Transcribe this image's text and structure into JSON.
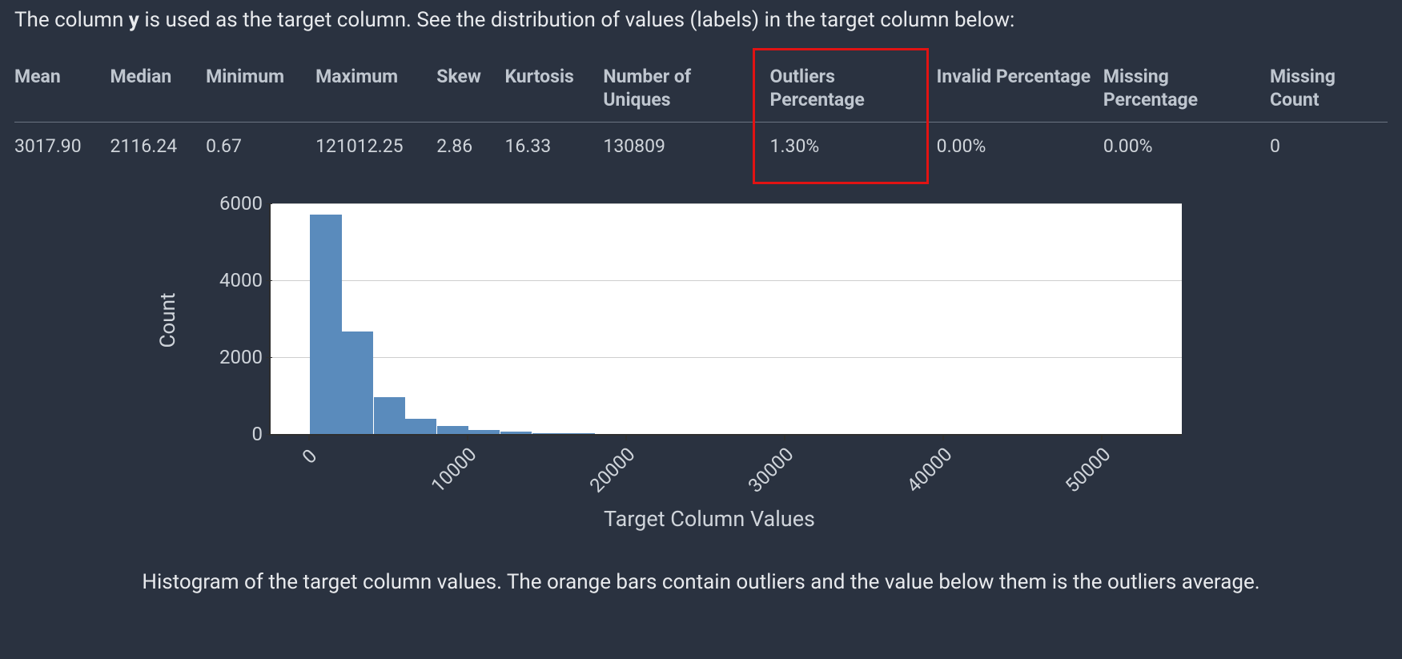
{
  "intro": {
    "prefix": "The column ",
    "bold": "y",
    "suffix": " is used as the target column. See the distribution of values (labels) in the target column below:"
  },
  "table": {
    "headers": [
      "Mean",
      "Median",
      "Minimum",
      "Maximum",
      "Skew",
      "Kurtosis",
      "Number of Uniques",
      "Outliers Percentage",
      "Invalid Percentage",
      "Missing Percentage",
      "Missing Count"
    ],
    "values": [
      "3017.90",
      "2116.24",
      "0.67",
      "121012.25",
      "2.86",
      "16.33",
      "130809",
      "1.30%",
      "0.00%",
      "0.00%",
      "0"
    ],
    "highlight_col_index": 7
  },
  "chart_data": {
    "type": "bar",
    "title": "",
    "xlabel": "Target Column Values",
    "ylabel": "Count",
    "ylim": [
      0,
      6000
    ],
    "yticks": [
      0,
      2000,
      4000,
      6000
    ],
    "xlim": [
      -2500,
      55000
    ],
    "xticks": [
      0,
      10000,
      20000,
      30000,
      40000,
      50000
    ],
    "bin_width": 2000,
    "bars": [
      {
        "x": 0,
        "count": 5700
      },
      {
        "x": 2000,
        "count": 2650
      },
      {
        "x": 4000,
        "count": 940
      },
      {
        "x": 6000,
        "count": 380
      },
      {
        "x": 8000,
        "count": 200
      },
      {
        "x": 10000,
        "count": 100
      },
      {
        "x": 12000,
        "count": 55
      },
      {
        "x": 14000,
        "count": 20
      },
      {
        "x": 16000,
        "count": 5
      }
    ]
  },
  "caption": "Histogram of the target column values. The orange bars contain outliers and the value below them is the outliers average.",
  "colors": {
    "bar": "#5a8bbc",
    "highlight": "#e11313",
    "bg": "#2a3240"
  }
}
